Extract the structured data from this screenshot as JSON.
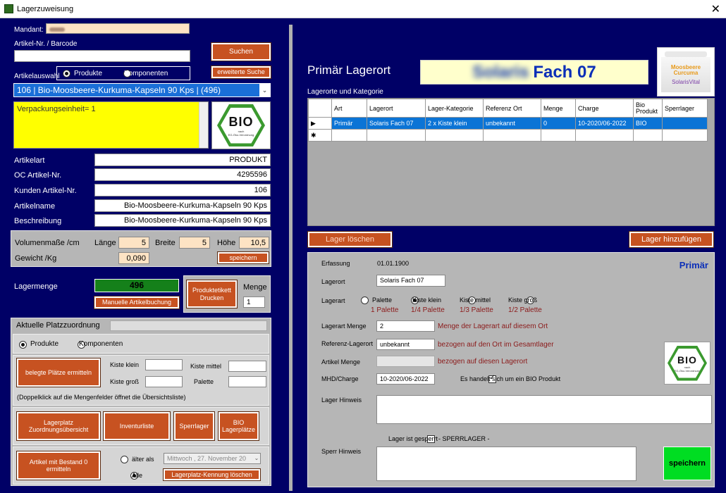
{
  "window": {
    "title": "Lagerzuweisung",
    "close": "✕"
  },
  "left": {
    "mandant_label": "Mandant:",
    "artikel_barcode_label": "Artikel-Nr. / Barcode",
    "suchen": "Suchen",
    "erweiterte_suche": "erweiterte Suche",
    "artikelauswahl_label": "Artikelauswahl",
    "radio_produkte": "Produkte",
    "radio_komponenten": "Komponenten",
    "artikel_select": "106    |    Bio-Moosbeere-Kurkuma-Kapseln 90 Kps    |    (496)",
    "verpackungseinheit": "Verpackungseinheit= 1",
    "bio_logo_text": "BIO",
    "bio_logo_sub1": "nach",
    "bio_logo_sub2": "EG-Öko-Verordnung",
    "fields": [
      {
        "label": "Artikelart",
        "value": "PRODUKT"
      },
      {
        "label": "OC Artikel-Nr.",
        "value": "4295596"
      },
      {
        "label": "Kunden Artikel-Nr.",
        "value": "106"
      },
      {
        "label": "Artikelname",
        "value": "Bio-Moosbeere-Kurkuma-Kapseln 90 Kps"
      },
      {
        "label": "Beschreibung",
        "value": "Bio-Moosbeere-Kurkuma-Kapseln 90 Kps"
      }
    ],
    "volumen_label": "Volumenmaße /cm",
    "laenge_label": "Länge",
    "laenge": "5",
    "breite_label": "Breite",
    "breite": "5",
    "hoehe_label": "Höhe",
    "hoehe": "10,5",
    "gewicht_label": "Gewicht /Kg",
    "gewicht": "0,090",
    "speichern": "speichern",
    "lagermenge_label": "Lagermenge",
    "lagermenge": "496",
    "manuelle_buchung": "Manuelle Artikelbuchung",
    "produktetikett": "Produktetikett Drucken",
    "menge_label": "Menge",
    "menge": "1",
    "platz_title": "Aktuelle Platzzuordnung",
    "platz_radio_produkte": "Produkte",
    "platz_radio_komponenten": "Komponenten",
    "belegte_plaetze": "belegte Plätze ermitteln",
    "kiste_klein": "Kiste klein",
    "kiste_mittel": "Kiste mittel",
    "kiste_gross": "Kiste groß",
    "palette": "Palette",
    "doppelklick_hint": "(Doppelklick auf die Mengenfelder öffnet die Übersichtsliste)",
    "btn_zuordnung": "Lagerplatz Zuordnungsübersicht",
    "btn_inventur": "Inventurliste",
    "btn_sperrlager": "Sperrlager",
    "btn_bio_lager": "BIO Lagerplätze",
    "btn_bestand0": "Artikel mit Bestand 0 ermitteln",
    "aelter_als": "älter als",
    "alle": "Alle",
    "date_select": "Mittwoch  , 27. November 20",
    "lagerplatz_kennung": "Lagerplatz-Kennung löschen"
  },
  "right": {
    "primaer_title": "Primär Lagerort",
    "fach_prefix_blur": "Solaris",
    "fach_label": "Fach 07",
    "product_image_label": "Moosbeere Curcuma",
    "product_brand": "SolarisVital",
    "lagerorte_label": "Lagerorte und Kategorie",
    "table": {
      "headers": [
        "Art",
        "Lagerort",
        "Lager-Kategorie",
        "Referenz Ort",
        "Menge",
        "Charge",
        "Bio Produkt",
        "Sperrlager"
      ],
      "rows": [
        [
          "Primär",
          "Solaris Fach 07",
          "2 x Kiste klein",
          "unbekannt",
          "0",
          "10-2020/06-2022",
          "BIO",
          ""
        ]
      ],
      "new_row_marker": "✱",
      "current_row_marker": "▶"
    },
    "lager_loeschen": "Lager löschen",
    "lager_hinzufuegen": "Lager hinzufügen",
    "detail": {
      "primaer_badge": "Primär",
      "erfassung_label": "Erfassung",
      "erfassung": "01.01.1900",
      "lagerort_label": "Lagerort",
      "lagerort": "Solaris Fach 07",
      "lagerart_label": "Lagerart",
      "lagerart_options": [
        {
          "label": "Palette",
          "sub": "1 Palette",
          "checked": false
        },
        {
          "label": "Kiste klein",
          "sub": "1/4 Palette",
          "checked": true
        },
        {
          "label": "Kiste mittel",
          "sub": "1/3 Palette",
          "checked": false
        },
        {
          "label": "Kiste groß",
          "sub": "1/2 Palette",
          "checked": false
        }
      ],
      "lagerart_menge_label": "Lagerart Menge",
      "lagerart_menge": "2",
      "lagerart_menge_hint": "Menge der Lagerart auf diesem Ort",
      "referenz_label": "Referenz-Lagerort",
      "referenz": "unbekannt",
      "referenz_hint": "bezogen auf den Ort im Gesamtlager",
      "artikel_menge_label": "Artikel Menge",
      "artikel_menge_hint": "bezogen auf diesen Lagerort",
      "mhd_label": "MHD/Charge",
      "mhd": "10-2020/06-2022",
      "bio_check_label": "Es handelt sich um ein BIO Produkt",
      "lager_hinweis_label": "Lager Hinweis",
      "gesperrt_label": "Lager ist gesperrt",
      "sperrlager_label": "- SPERRLAGER -",
      "sperr_hinweis_label": "Sperr Hinweis",
      "speichern": "speichern"
    }
  },
  "colors": {
    "background": "#000066",
    "orange_button": "#c75221",
    "yellow_field": "#ffff00",
    "green_save": "#00dd22",
    "selected_row": "#0b74d6"
  }
}
